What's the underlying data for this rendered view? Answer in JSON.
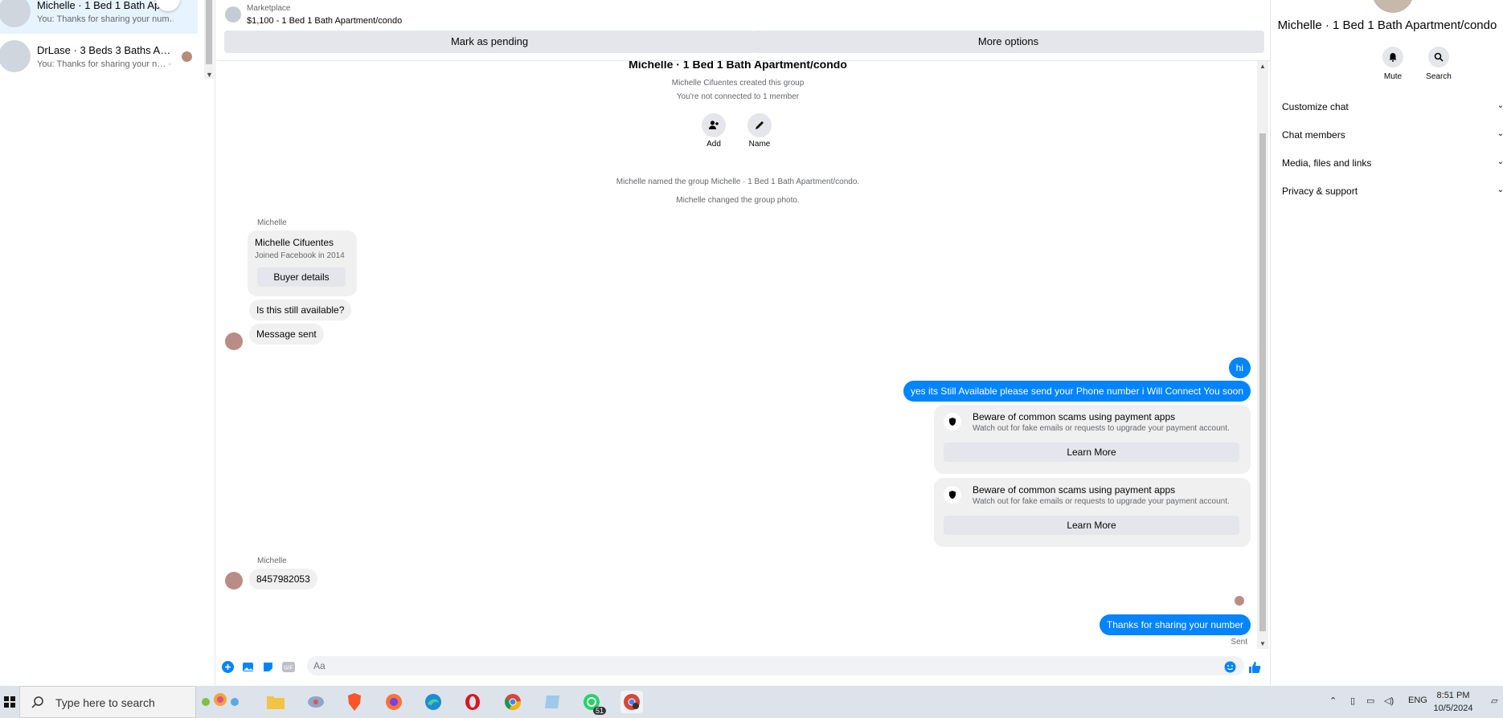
{
  "sidebar": {
    "conversations": [
      {
        "title": "Michelle · 1 Bed 1 Bath Apar…",
        "preview": "You: Thanks for sharing your num…m",
        "menu_glyph": "•••"
      },
      {
        "title": "DrLase · 3 Beds 3 Baths Apar…",
        "preview": "You: Thanks for sharing your n… · 6d"
      }
    ]
  },
  "header": {
    "label": "Marketplace",
    "listing": "$1,100 - 1 Bed 1 Bath Apartment/condo",
    "mark_pending": "Mark as pending",
    "more_options": "More options"
  },
  "chat": {
    "group_title": "Michelle · 1 Bed 1 Bath Apartment/condo",
    "created": "Michelle Cifuentes created this group",
    "not_connected": "You're not connected to 1 member",
    "add_label": "Add",
    "name_label": "Name",
    "sys1": "Michelle named the group Michelle · 1 Bed 1 Bath Apartment/condo.",
    "sys2": "Michelle changed the group photo.",
    "sender1": "Michelle",
    "buyer_name": "Michelle Cifuentes",
    "buyer_joined": "Joined Facebook in 2014",
    "buyer_details": "Buyer details",
    "msg_available": "Is this still available?",
    "msg_sent": "Message sent",
    "out_hi": "hi",
    "out_available": "yes its Still Available please send your Phone number i Will Connect You soon",
    "scam_title": "Beware of common scams using payment apps",
    "scam_text": "Watch out for fake emails or requests to upgrade your payment account.",
    "learn_more": "Learn More",
    "sender2": "Michelle",
    "msg_number": "8457982053",
    "out_thanks": "Thanks for sharing your number",
    "status": "Sent"
  },
  "composer": {
    "placeholder": "Aa"
  },
  "right_panel": {
    "title": "Michelle · 1 Bed 1 Bath Apartment/condo",
    "mute": "Mute",
    "search": "Search",
    "sections": [
      "Customize chat",
      "Chat members",
      "Media, files and links",
      "Privacy & support"
    ]
  },
  "taskbar": {
    "search_placeholder": "Type here to search",
    "whatsapp_badge": "51",
    "lang": "ENG",
    "time": "8:51 PM",
    "date": "10/5/2024"
  },
  "colors": {
    "accent": "#0084ff",
    "bubble_in": "#f0f0f0",
    "button": "#e4e6eb"
  }
}
